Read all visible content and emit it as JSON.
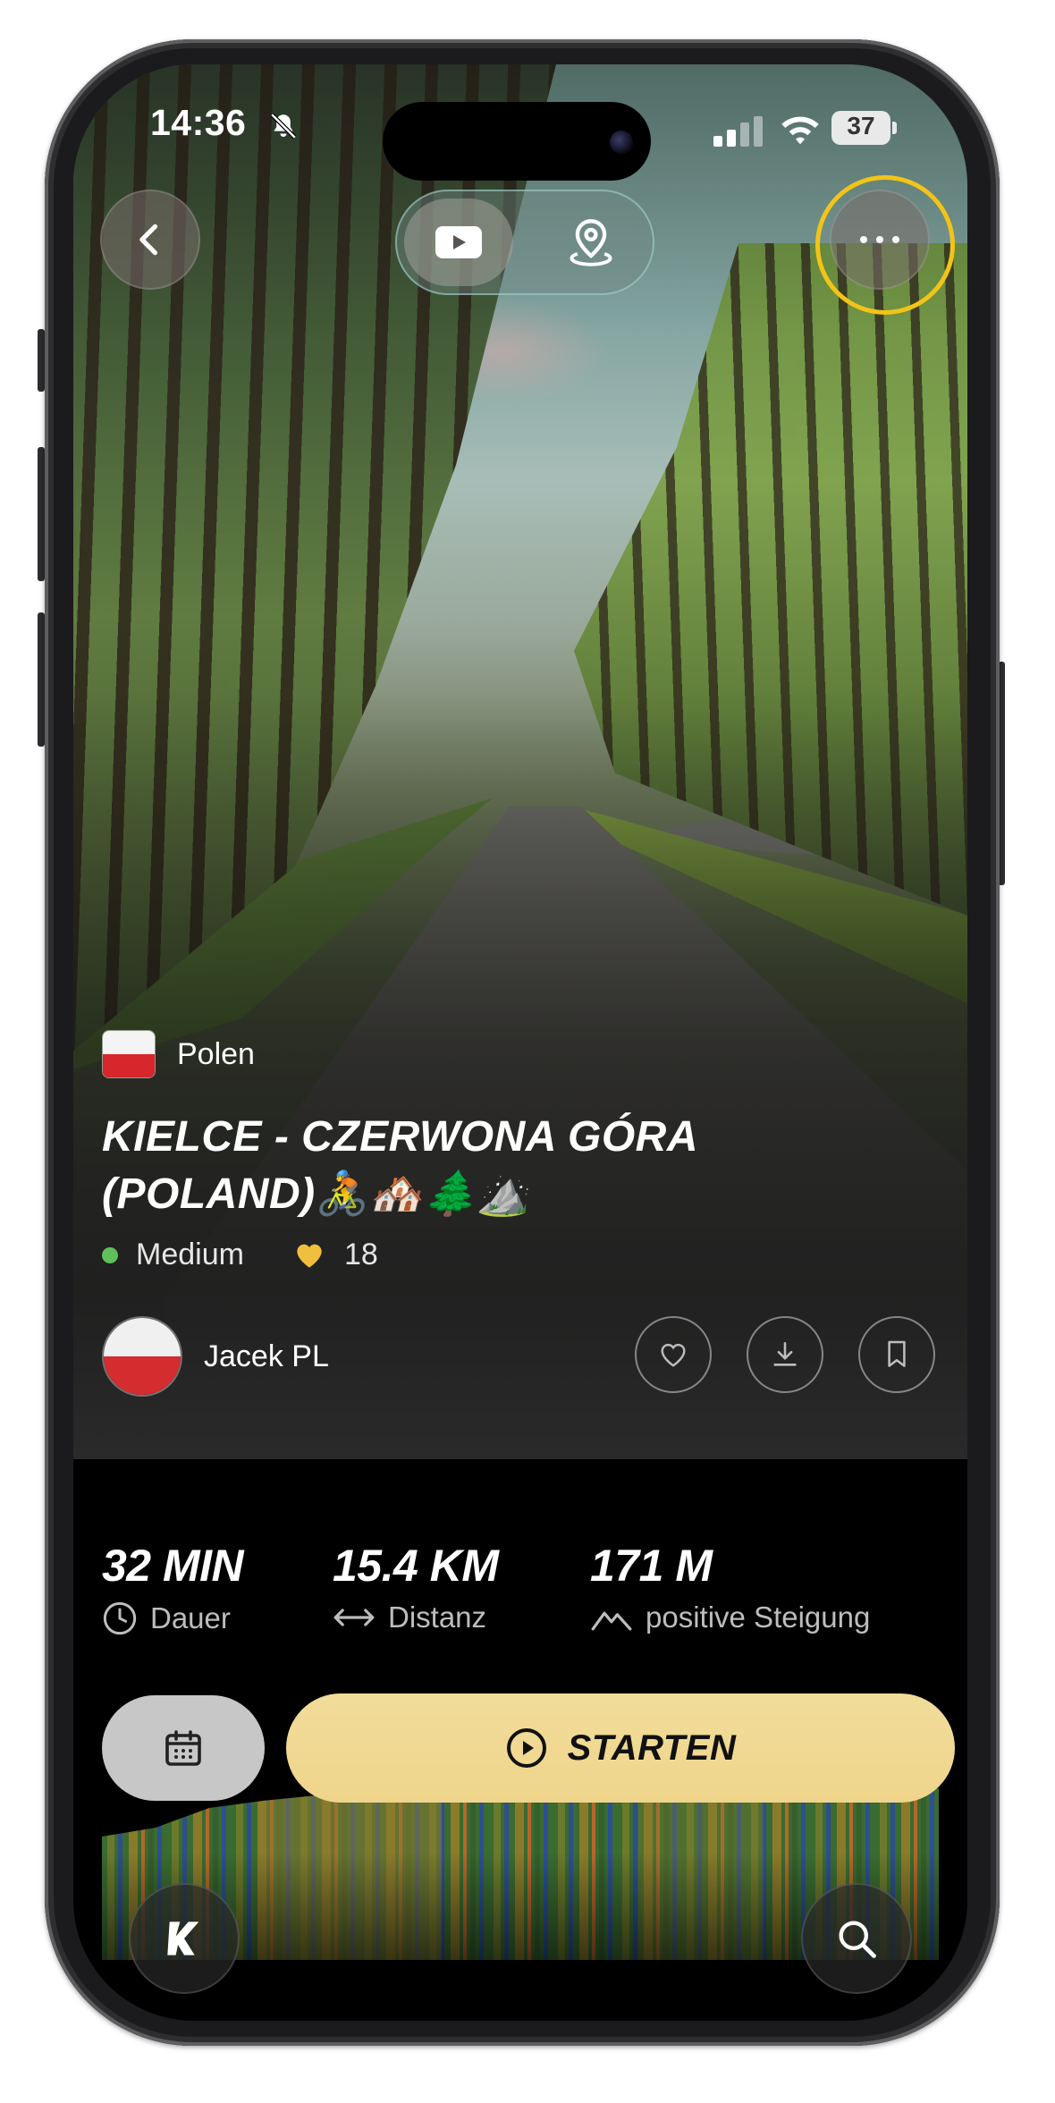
{
  "status_bar": {
    "time": "14:36",
    "battery": "37"
  },
  "header": {
    "back_icon": "chevron-left-icon",
    "view_toggle": [
      {
        "icon": "video-play-icon",
        "active": true
      },
      {
        "icon": "map-pin-icon",
        "active": false
      }
    ],
    "more_icon": "more-horizontal-icon",
    "highlight_color": "#f2c418"
  },
  "route": {
    "country": "Polen",
    "title": "KIELCE - CZERWONA GÓRA (POLAND)🚴🏘️🌲⛰️",
    "difficulty": "Medium",
    "difficulty_color": "#5fbf5a",
    "likes": "18",
    "author": "Jacek PL"
  },
  "actions": [
    "heart-icon",
    "download-icon",
    "bookmark-icon"
  ],
  "stats": [
    {
      "value": "32 MIN",
      "label": "Dauer",
      "icon": "clock-icon"
    },
    {
      "value": "15.4 KM",
      "label": "Distanz",
      "icon": "arrows-horizontal-icon"
    },
    {
      "value": "171 M",
      "label": "positive Steigung",
      "icon": "mountain-icon"
    }
  ],
  "buttons": {
    "calendar_icon": "calendar-icon",
    "start_label": "STARTEN",
    "start_color": "#efd58b"
  },
  "nav": {
    "left_icon": "app-logo-icon",
    "right_icon": "search-icon"
  }
}
